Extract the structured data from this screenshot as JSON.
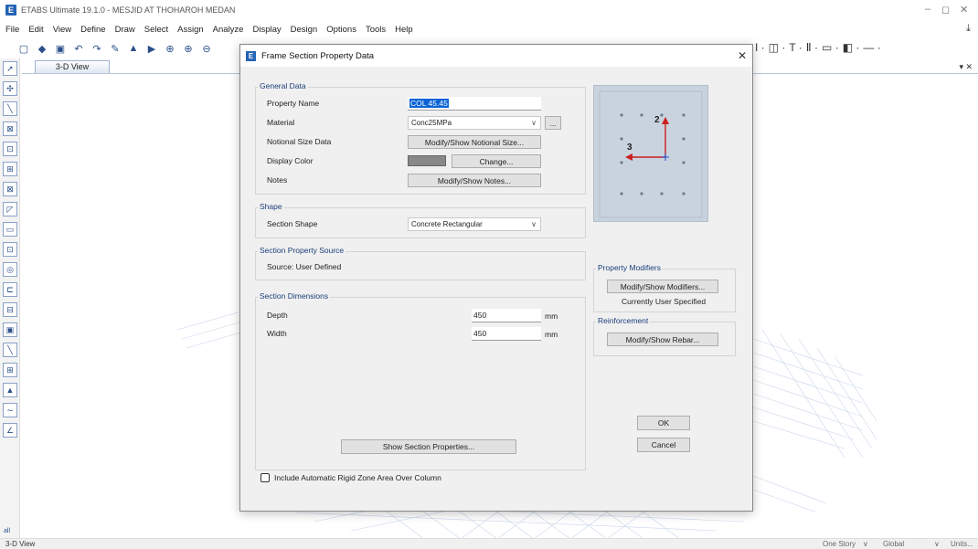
{
  "app": {
    "title": "ETABS Ultimate 19.1.0 - MESJID AT THOHAROH MEDAN",
    "logo": "E"
  },
  "menu": [
    "File",
    "Edit",
    "View",
    "Define",
    "Draw",
    "Select",
    "Assign",
    "Analyze",
    "Display",
    "Design",
    "Options",
    "Tools",
    "Help"
  ],
  "view": {
    "tab_label": "3-D View",
    "palette_bottom_label": "all"
  },
  "status": {
    "left": "3-D View",
    "story": "One Story",
    "coord": "Global",
    "units": "Units..."
  },
  "dialog": {
    "title": "Frame Section Property Data",
    "logo": "E",
    "general": {
      "legend": "General Data",
      "property_name_label": "Property Name",
      "property_name_value": "COL 45.45",
      "material_label": "Material",
      "material_value": "Conc25MPa",
      "material_more": "...",
      "notional_label": "Notional Size Data",
      "notional_button": "Modify/Show Notional Size...",
      "color_label": "Display Color",
      "color_button": "Change...",
      "notes_label": "Notes",
      "notes_button": "Modify/Show Notes..."
    },
    "shape": {
      "legend": "Shape",
      "section_shape_label": "Section Shape",
      "section_shape_value": "Concrete Rectangular"
    },
    "source": {
      "legend": "Section Property Source",
      "text": "Source:  User Defined"
    },
    "dimensions": {
      "legend": "Section Dimensions",
      "depth_label": "Depth",
      "depth_value": "450",
      "depth_unit": "mm",
      "width_label": "Width",
      "width_value": "450",
      "width_unit": "mm"
    },
    "preview": {
      "axis2": "2",
      "axis3": "3"
    },
    "modifiers": {
      "legend": "Property Modifiers",
      "button": "Modify/Show Modifiers...",
      "status": "Currently User Specified"
    },
    "reinforcement": {
      "legend": "Reinforcement",
      "button": "Modify/Show Rebar..."
    },
    "show_props_button": "Show Section Properties...",
    "ok_button": "OK",
    "cancel_button": "Cancel",
    "rigid_zone_label": "Include Automatic Rigid Zone Area Over Column",
    "rigid_zone_checked": false
  },
  "colors": {
    "accent": "#2463b5",
    "display_color": "#888888",
    "preview_bg": "#c9d3de",
    "axis2": "#cc1f1f",
    "axis3": "#cc1f1f"
  }
}
